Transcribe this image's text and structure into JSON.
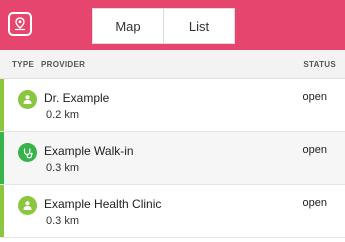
{
  "header": {
    "map_icon": "map-pin-icon",
    "tabs": [
      {
        "label": "Map"
      },
      {
        "label": "List"
      }
    ]
  },
  "columns": {
    "type": "TYPE",
    "provider": "PROVIDER",
    "status": "STATUS"
  },
  "providers": [
    {
      "name": "Dr. Example",
      "distance": "0.2 km",
      "status": "open",
      "icon": "person-icon",
      "color": "#8cc63f"
    },
    {
      "name": "Example Walk-in",
      "distance": "0.3 km",
      "status": "open",
      "icon": "stethoscope-icon",
      "color": "#37b34a"
    },
    {
      "name": "Example Health Clinic",
      "distance": "0.3 km",
      "status": "open",
      "icon": "person-icon",
      "color": "#8cc63f"
    }
  ],
  "colors": {
    "brand": "#e6456e",
    "light_green": "#8cc63f",
    "green": "#37b34a"
  }
}
